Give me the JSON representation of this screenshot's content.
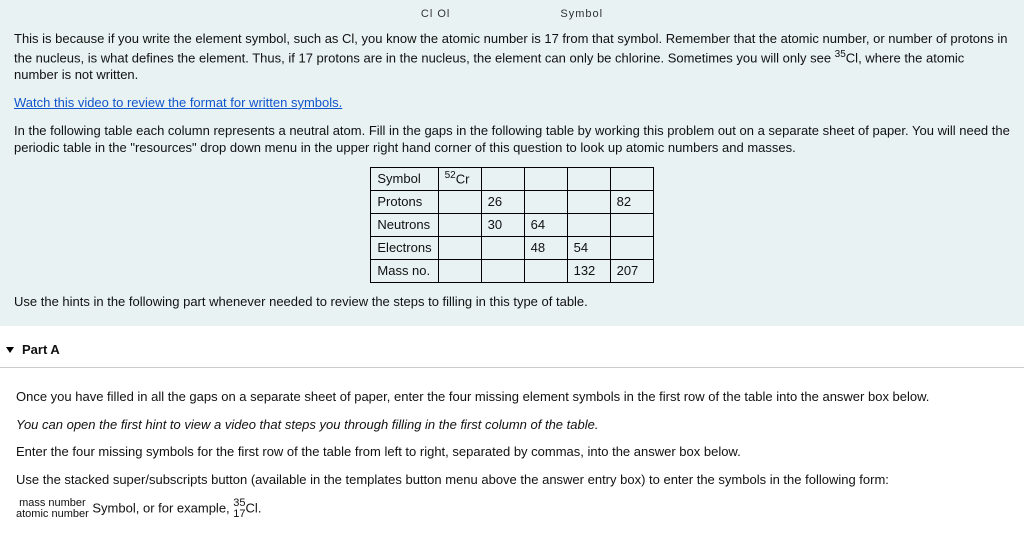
{
  "header_cutoff": {
    "left": "Cl Ol",
    "right": "Symbol"
  },
  "intro": {
    "p1a": "This is because if you write the element symbol, such as Cl, you know the atomic number is 17 from that symbol. Remember that the atomic number, or number of protons in the nucleus, is what defines the element. Thus, if 17 protons are in the nucleus, the element can only be chlorine. Sometimes you will only see ",
    "iso_sup": "35",
    "iso_sym": "Cl",
    "p1b": ", where the atomic number is not written.",
    "video_link": "Watch this video to review the format for written symbols.",
    "p2": "In the following table each column represents a neutral atom. Fill in the gaps in the following table by working this problem out on a separate sheet of paper. You will need the periodic table in the \"resources\" drop down menu in the upper right hand corner of this question to look up atomic numbers and masses."
  },
  "table": {
    "rows": [
      "Symbol",
      "Protons",
      "Neutrons",
      "Electrons",
      "Mass no."
    ],
    "symbol_sup": "52",
    "symbol_el": "Cr",
    "data": {
      "protons_c2": "26",
      "protons_c5": "82",
      "neutrons_c2": "30",
      "neutrons_c3": "64",
      "electrons_c3": "48",
      "electrons_c4": "54",
      "mass_c4": "132",
      "mass_c5": "207"
    }
  },
  "hint_line": "Use the hints in the following part whenever needed to review the steps to filling in this type of table.",
  "partA": {
    "label": "Part A",
    "p1": "Once you have filled in all the gaps on a separate sheet of paper, enter the four missing element symbols in the first row of the table into the answer box below.",
    "p2": "You can open the first hint to view a video that steps you through filling in the first column of the table.",
    "p3": "Enter the four missing symbols for the first row of the table from left to right, separated by commas, into the answer box below.",
    "p4": "Use the stacked super/subscripts button (available in the templates button menu above the answer entry box) to enter the symbols in the following form:",
    "frac_top": "mass number",
    "frac_bot": "atomic number",
    "after_frac": "Symbol, or for example, ",
    "ex_sup": "35",
    "ex_sub": "17",
    "ex_sym": "Cl",
    "period": "."
  }
}
